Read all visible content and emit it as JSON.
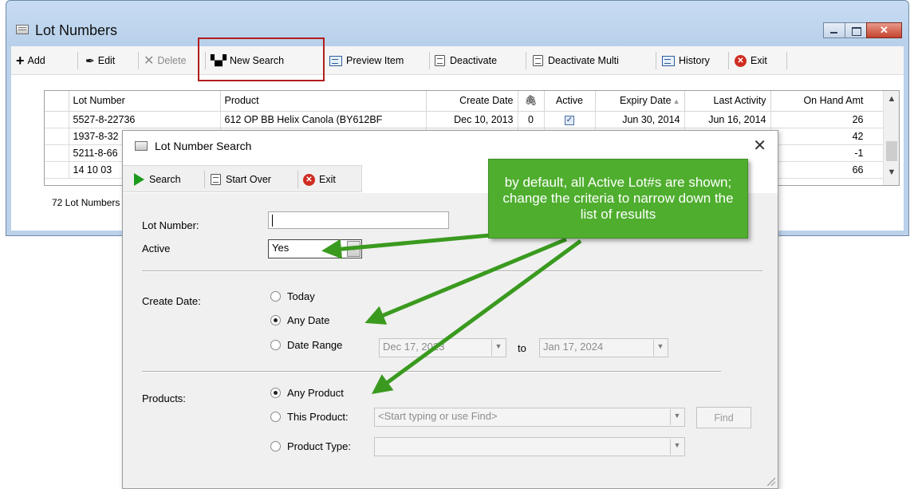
{
  "main_window": {
    "title": "Lot Numbers",
    "toolbar": {
      "add": "Add",
      "edit": "Edit",
      "delete": "Delete",
      "new_search": "New Search",
      "preview_item": "Preview Item",
      "deactivate": "Deactivate",
      "deactivate_multi": "Deactivate Multi",
      "history": "History",
      "exit": "Exit"
    },
    "grid": {
      "columns": [
        "Lot Number",
        "Product",
        "Create Date",
        "",
        "Active",
        "Expiry Date",
        "Last Activity",
        "On Hand Amt"
      ],
      "rows": [
        {
          "lot": "5527-8-22736",
          "product": "612 OP BB Helix Canola (BY612BF",
          "create": "Dec 10, 2013",
          "attach": "0",
          "active": true,
          "expiry": "Jun 30, 2014",
          "last": "Jun 16, 2014",
          "onhand": "26"
        },
        {
          "lot": "1937-8-32",
          "onhand": "42"
        },
        {
          "lot": "5211-8-66",
          "onhand": "-1"
        },
        {
          "lot": "14 10 03",
          "onhand": "66"
        }
      ]
    },
    "status": "72 Lot Numbers"
  },
  "dialog": {
    "title": "Lot Number Search",
    "toolbar": {
      "search": "Search",
      "start_over": "Start Over",
      "exit": "Exit"
    },
    "lot_number_label": "Lot Number:",
    "lot_number_value": "",
    "active_label": "Active",
    "active_value": "Yes",
    "create_date_label": "Create Date:",
    "create_date_options": {
      "today": "Today",
      "any_date": "Any Date",
      "date_range": "Date Range"
    },
    "create_date_selected": "Any Date",
    "date_from": "Dec 17, 2023",
    "date_to_label": "to",
    "date_to": "Jan 17, 2024",
    "products_label": "Products:",
    "product_options": {
      "any": "Any Product",
      "this": "This Product:",
      "type": "Product Type:"
    },
    "product_selected": "Any Product",
    "product_placeholder": "<Start typing or use Find>",
    "find_label": "Find"
  },
  "callout": {
    "text": "by default, all Active Lot#s are shown; change the criteria to narrow down the list of results",
    "color": "#4fae2e"
  }
}
